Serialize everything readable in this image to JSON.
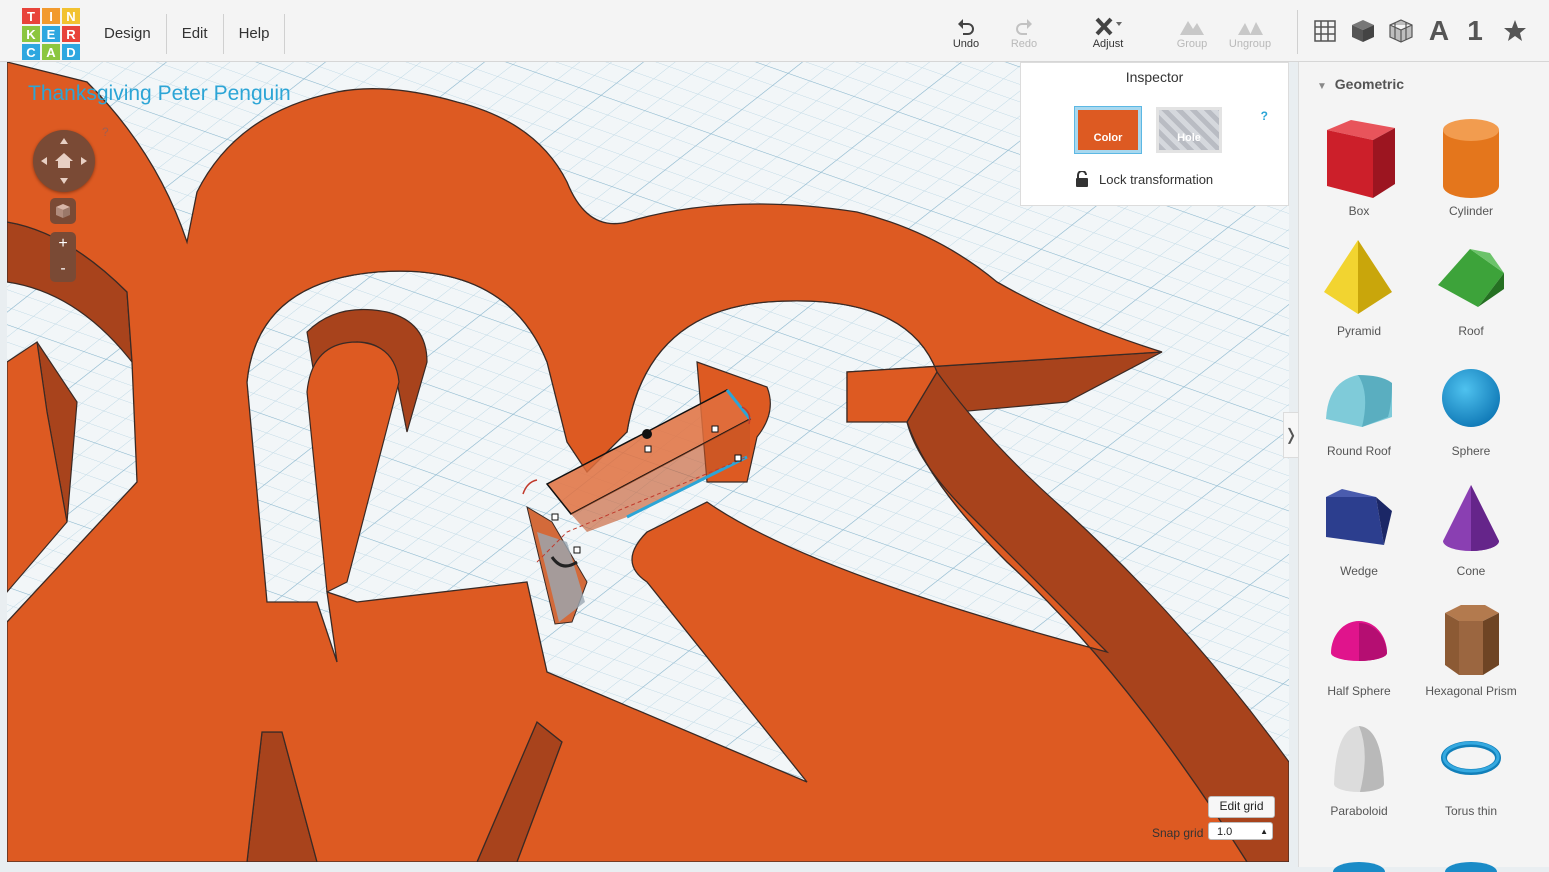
{
  "logo": {
    "letters": [
      "T",
      "I",
      "N",
      "K",
      "E",
      "R",
      "C",
      "A",
      "D"
    ],
    "colors": [
      "#e8433a",
      "#f29a2e",
      "#f2c230",
      "#8cc63f",
      "#2ea7e0",
      "#e8433a",
      "#2ea7e0",
      "#8cc63f",
      "#2ea7e0"
    ]
  },
  "menu": {
    "items": [
      "Design",
      "Edit",
      "Help"
    ]
  },
  "toolbar": {
    "undo": "Undo",
    "redo": "Redo",
    "adjust": "Adjust",
    "group": "Group",
    "ungroup": "Ungroup",
    "text_tool": "A",
    "number_tool": "1"
  },
  "project": {
    "title": "Thanksgiving Peter Penguin"
  },
  "nav": {
    "help": "?",
    "zoom_in": "+",
    "zoom_out": "-"
  },
  "inspector": {
    "title": "Inspector",
    "color_label": "Color",
    "hole_label": "Hole",
    "help": "?",
    "lock_label": "Lock transformation",
    "color_value": "#dd5a22"
  },
  "sidebar": {
    "category": "Geometric",
    "shapes": [
      {
        "name": "Box",
        "icon": "box-shape-icon"
      },
      {
        "name": "Cylinder",
        "icon": "cylinder-shape-icon"
      },
      {
        "name": "Pyramid",
        "icon": "pyramid-shape-icon"
      },
      {
        "name": "Roof",
        "icon": "roof-shape-icon"
      },
      {
        "name": "Round Roof",
        "icon": "round-roof-shape-icon"
      },
      {
        "name": "Sphere",
        "icon": "sphere-shape-icon"
      },
      {
        "name": "Wedge",
        "icon": "wedge-shape-icon"
      },
      {
        "name": "Cone",
        "icon": "cone-shape-icon"
      },
      {
        "name": "Half Sphere",
        "icon": "half-sphere-shape-icon"
      },
      {
        "name": "Hexagonal Prism",
        "icon": "hexagonal-prism-shape-icon"
      },
      {
        "name": "Paraboloid",
        "icon": "paraboloid-shape-icon"
      },
      {
        "name": "Torus thin",
        "icon": "torus-thin-shape-icon"
      }
    ]
  },
  "grid": {
    "edit_label": "Edit grid",
    "snap_label": "Snap grid",
    "snap_value": "1.0"
  }
}
